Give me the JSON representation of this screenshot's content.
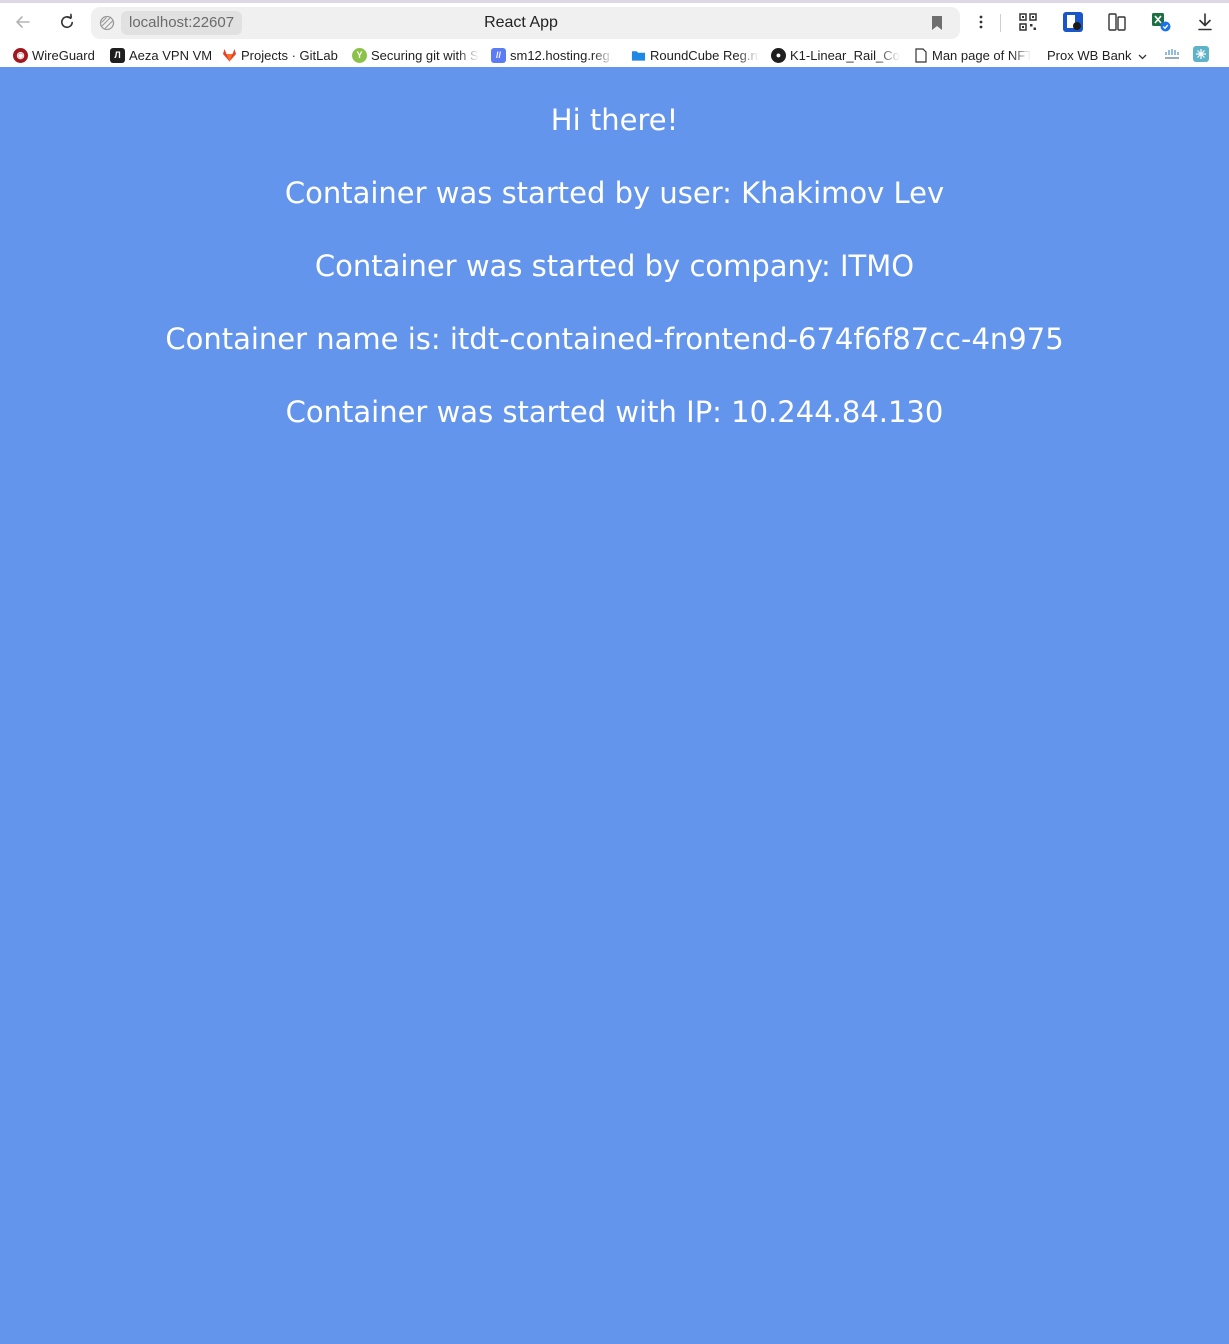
{
  "browser": {
    "address": "localhost:22607",
    "tab_title": "React App"
  },
  "bookmarks": [
    {
      "label": "WireGuard",
      "icon": "wireguard-icon"
    },
    {
      "label": "Aeza VPN VM",
      "icon": "aeza-icon"
    },
    {
      "label": "Projects · GitLab",
      "icon": "gitlab-icon"
    },
    {
      "label": "Securing git with S",
      "icon": "yandex-icon"
    },
    {
      "label": "sm12.hosting.reg.",
      "icon": "hosting-icon"
    },
    {
      "label": "RoundCube Reg.ru",
      "icon": "folder-icon"
    },
    {
      "label": "K1-Linear_Rail_Co",
      "icon": "github-icon"
    },
    {
      "label": "Man page of NFT",
      "icon": "page-icon"
    },
    {
      "label": "Prox WB Bank",
      "icon": "chevron-down-icon"
    }
  ],
  "page": {
    "greeting": "Hi there!",
    "user_line": "Container was started by user: Khakimov Lev",
    "company_line": "Container was started by company: ITMO",
    "name_line": "Container name is: itdt-contained-frontend-674f6f87cc-4n975",
    "ip_line": "Container was started with IP: 10.244.84.130"
  },
  "colors": {
    "page_background": "#6495ED",
    "text": "#FFFFFF"
  }
}
